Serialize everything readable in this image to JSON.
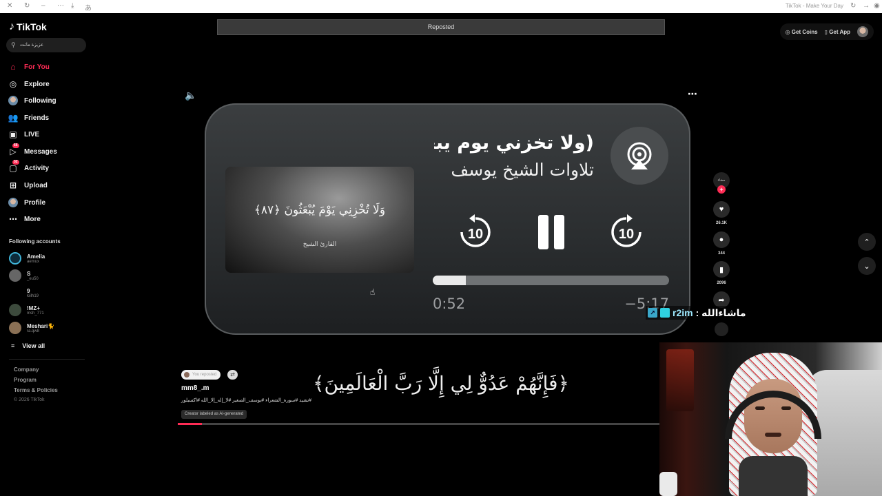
{
  "browser": {
    "window_title": "TikTok - Make Your Day"
  },
  "sidebar": {
    "logo_text": "TikTok",
    "search_value": "عزيزة ماتت",
    "nav": [
      {
        "label": "For You",
        "icon": "home-icon",
        "active": true
      },
      {
        "label": "Explore",
        "icon": "compass-icon"
      },
      {
        "label": "Following",
        "icon": "avatar-icon"
      },
      {
        "label": "Friends",
        "icon": "friends-icon"
      },
      {
        "label": "LIVE",
        "icon": "live-icon"
      },
      {
        "label": "Messages",
        "icon": "messages-icon",
        "badge": "66"
      },
      {
        "label": "Activity",
        "icon": "activity-icon",
        "badge": "32"
      },
      {
        "label": "Upload",
        "icon": "upload-icon"
      },
      {
        "label": "Profile",
        "icon": "profile-avatar-icon"
      },
      {
        "label": "More",
        "icon": "more-icon"
      }
    ],
    "following_title": "Following accounts",
    "following": [
      {
        "name": "Amelia",
        "handle": "aemux"
      },
      {
        "name": "S",
        "handle": "_eu50"
      },
      {
        "name": "9",
        "handle": "kiilh19"
      },
      {
        "name": "!MZ+",
        "handle": "msh_771"
      },
      {
        "name": "Meshari🐈",
        "handle": "ra.qw8"
      }
    ],
    "view_all": "View all",
    "footer_links": [
      "Company",
      "Program",
      "Terms & Policies"
    ],
    "copyright": "© 2026 TikTok"
  },
  "topbar": {
    "reposted": "Reposted",
    "get_coins": "Get Coins",
    "get_app": "Get App"
  },
  "player": {
    "title": "(ولا تخزني يوم يبعثون",
    "author": "تلاوات الشيخ يوسف",
    "artwork_ayah": "وَلَا تُخْزِنِي يَوْمَ يُبْعَثُونَ ﴿٨٧﴾",
    "artwork_reciter": "القارئ الشيخ",
    "skip_back": "10",
    "skip_forward": "10",
    "elapsed": "0:52",
    "remaining": "−5:17",
    "progress": 0.14
  },
  "post": {
    "caption_ayah": "﴿فَإِنَّهُمْ عَدُوٌّ لِي إِلَّا رَبَّ الْعَالَمِينَ﴾",
    "reposted_pill": "You reposted",
    "username": "mm8_.m",
    "hashtags": "#نشيد #سورة_الشعراء #يوسف_الصغير #لا_إله_إلا_الله #اكسبلور",
    "ai_label": "Creator labeled as AI-generated",
    "video_progress": 0.05
  },
  "actions": {
    "avatar_text": "مشاء",
    "likes": "26.1K",
    "comments": "344",
    "saves": "2096"
  },
  "overlay_chat": {
    "nick": "r2im",
    "message": ": ماشاءالله"
  },
  "colors": {
    "accent": "#fe2c55",
    "background": "#000000"
  }
}
